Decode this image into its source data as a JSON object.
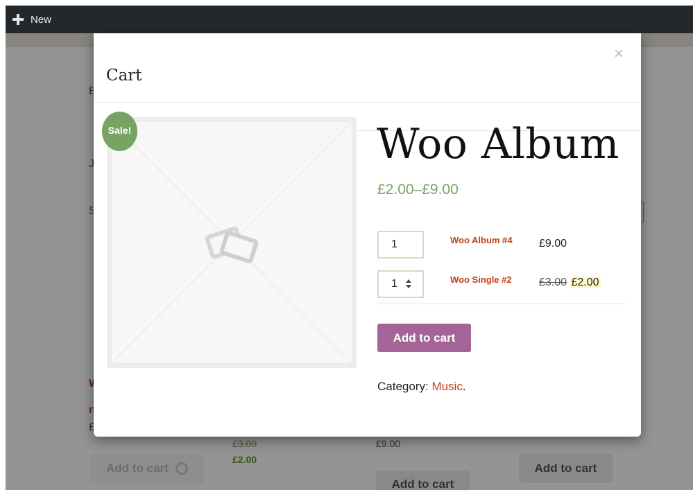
{
  "admin_bar": {
    "new_label": "New"
  },
  "background": {
    "products": [
      {
        "old_price": "£3.00",
        "new_price": "£2.00"
      },
      {
        "price": "£9.00",
        "button": "Add to cart"
      },
      {
        "button": "Add to cart"
      },
      {
        "button": "Add to cart"
      }
    ],
    "fragments": [
      "B",
      "J",
      "S",
      "W",
      "n",
      "£"
    ]
  },
  "modal": {
    "title": "Cart",
    "close": "×",
    "sale_badge": "Sale!",
    "product_title": "Woo Album",
    "price_range": "£2.00–£9.00",
    "items": [
      {
        "qty": "1",
        "name": "Woo Album #4",
        "price": "£9.00"
      },
      {
        "qty": "1",
        "name": "Woo Single #2",
        "old_price": "£3.00",
        "sale_price": "£2.00"
      }
    ],
    "add_to_cart": "Add to cart",
    "category_label": "Category: ",
    "category_link": "Music",
    "category_suffix": "."
  },
  "colors": {
    "admin_bar": "#23282d",
    "sale_green": "#77a464",
    "button_purple": "#a46497",
    "link_red": "#c1411b"
  }
}
